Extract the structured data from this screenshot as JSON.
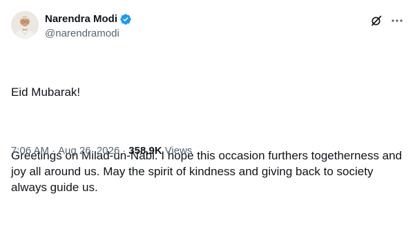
{
  "author": {
    "display_name": "Narendra Modi",
    "handle": "@narendramodi",
    "verified_icon": "verified-badge-icon",
    "avatar_alt": "profile-photo"
  },
  "actions": {
    "grok_icon": "grok-icon",
    "more_icon": "more-options-icon"
  },
  "post": {
    "line1": "Eid Mubarak!",
    "line2": "Greetings on Milad-un-Nabi. I hope this occasion furthers togetherness and joy all around us. May the spirit of kindness and giving back to society always guide us."
  },
  "meta": {
    "time": "7:06 AM",
    "separator": "·",
    "date": "Aug 26, 2026",
    "views_separator": "·",
    "views_count": "358.9K",
    "views_label": "Views"
  },
  "colors": {
    "text_primary": "#0f1419",
    "text_secondary": "#536471",
    "verified_blue": "#1d9bf0"
  }
}
